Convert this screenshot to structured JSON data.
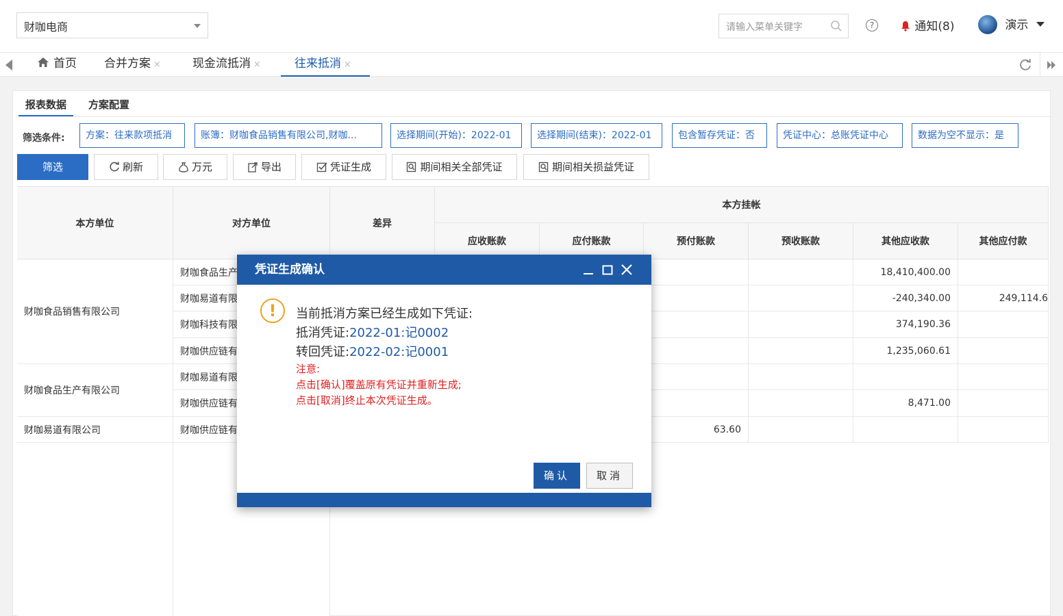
{
  "header": {
    "company": "财咖电商",
    "search_placeholder": "请输入菜单关键字",
    "help": "?",
    "notify_label": "通知(8)",
    "user_name": "演示"
  },
  "tabs": [
    {
      "label": "首页"
    },
    {
      "label": "合并方案",
      "close": "×"
    },
    {
      "label": "现金流抵消",
      "close": "×"
    },
    {
      "label": "往来抵消",
      "close": "×"
    }
  ],
  "subtabs": [
    "报表数据",
    "方案配置"
  ],
  "filter": {
    "label": "筛选条件:",
    "chips": [
      "方案：往来款项抵消",
      "账簿：财咖食品销售有限公司,财咖...",
      "选择期间(开始)：2022-01",
      "选择期间(结束)：2022-01",
      "包含暂存凭证：否",
      "凭证中心：总账凭证中心",
      "数据为空不显示：是"
    ]
  },
  "buttons": {
    "filter": "筛选",
    "refresh": "刷新",
    "wan": "万元",
    "export": "导出",
    "gen_voucher": "凭证生成",
    "all_vouchers": "期间相关全部凭证",
    "pl_vouchers": "期间相关损益凭证"
  },
  "table": {
    "headers": {
      "own_unit": "本方单位",
      "counter_unit": "对方单位",
      "diff": "差异",
      "group": "本方挂帐",
      "cols": [
        "应收账款",
        "应付账款",
        "预付账款",
        "预收账款",
        "其他应收款",
        "其他应付款"
      ]
    },
    "groups": [
      {
        "own": "财咖食品销售有限公司"
      },
      {
        "own": "财咖食品生产有限公司"
      },
      {
        "own": "财咖易道有限公司"
      }
    ],
    "rows": [
      {
        "counter": "财咖食品生产",
        "prepaid": "",
        "other_recv": "18,410,400.00",
        "other_pay": ""
      },
      {
        "counter": "财咖易道有限",
        "prepaid": "",
        "other_recv": "-240,340.00",
        "other_pay": "249,114.6"
      },
      {
        "counter": "财咖科技有限",
        "prepaid": "",
        "other_recv": "374,190.36",
        "other_pay": ""
      },
      {
        "counter": "财咖供应链有",
        "prepaid": "",
        "other_recv": "1,235,060.61",
        "other_pay": ""
      },
      {
        "counter": "财咖易道有限",
        "prepaid": "",
        "other_recv": "",
        "other_pay": ""
      },
      {
        "counter": "财咖供应链有",
        "prepaid": "",
        "other_recv": "8,471.00",
        "other_pay": ""
      },
      {
        "counter": "财咖供应链有",
        "prepaid": "63.60",
        "other_recv": "",
        "other_pay": ""
      }
    ]
  },
  "dialog": {
    "title": "凭证生成确认",
    "icon": "!",
    "line1": "当前抵消方案已经生成如下凭证:",
    "line2_prefix": "抵消凭证:",
    "line2_link": "2022-01:记0002",
    "line3_prefix": "转回凭证:",
    "line3_link": "2022-02:记0001",
    "note_title": "注意:",
    "note1": "点击[确认]覆盖原有凭证并重新生成;",
    "note2": "点击[取消]终止本次凭证生成。",
    "ok": "确认",
    "cancel": "取消"
  },
  "colors": {
    "primary": "#2b6cc4",
    "dialog_blue": "#1f5aa6",
    "warning": "#f0a020",
    "danger": "#e02020"
  }
}
